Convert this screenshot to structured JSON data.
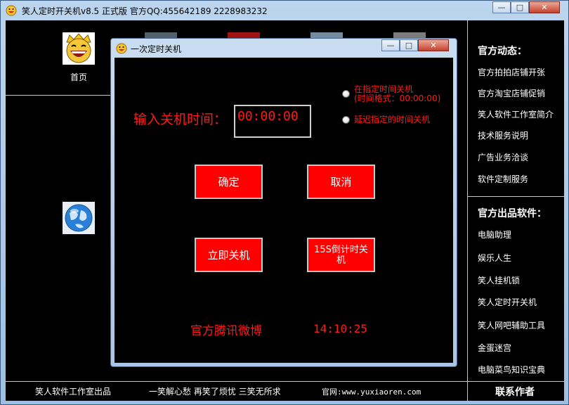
{
  "main_window": {
    "title": "笑人定时开关机v8.5 正式版     官方QQ:455642189 2228983232",
    "buttons": {
      "minimize": "—",
      "maximize": "□",
      "close": "✕"
    }
  },
  "home": {
    "label": "首页",
    "icon": "laughing-face-icon"
  },
  "sidebar": {
    "news_heading": "官方动态：",
    "news_links": [
      "官方拍拍店铺开张",
      "官方淘宝店铺促销",
      "笑人软件工作室简介",
      "技术服务说明",
      "广告业务洽谈",
      "软件定制服务"
    ],
    "products_heading": "官方出品软件：",
    "product_links": [
      "电脑助理",
      "娱乐人生",
      "笑人挂机锁",
      "笑人定时开关机",
      "笑人网吧辅助工具",
      "金蛋迷宫",
      "电脑菜鸟知识宝典"
    ]
  },
  "footer": {
    "studio": "笑人软件工作室出品",
    "slogan": "一笑解心愁 再笑了烦忧 三笑无所求",
    "website": "官网:www.yuxiaoren.com",
    "contact": "联系作者"
  },
  "dialog": {
    "title": "一次定时关机",
    "time_label": "输入关机时间：",
    "time_value": "00:00:00",
    "radio1_line1": "在指定时间关机",
    "radio1_line2": "(时间格式：00:00:00)",
    "radio2": "延迟指定的时间关机",
    "ok": "确定",
    "cancel": "取消",
    "shutdown_now": "立即关机",
    "countdown": "15S倒计时关机",
    "weibo": "官方腾讯微博",
    "clock": "14:10:25"
  },
  "colors": {
    "accent": "#ff0000",
    "background": "#000000"
  }
}
